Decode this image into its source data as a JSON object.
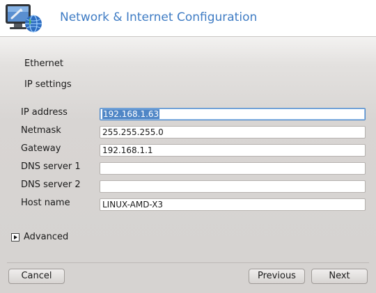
{
  "header": {
    "title": "Network & Internet Configuration",
    "logo_icon": "network-monitor-globe-icon"
  },
  "sections": {
    "ethernet": "Ethernet",
    "ip_settings": "IP settings"
  },
  "fields": {
    "ip_address": {
      "label": "IP address",
      "value": "192.168.1.63"
    },
    "netmask": {
      "label": "Netmask",
      "value": "255.255.255.0"
    },
    "gateway": {
      "label": "Gateway",
      "value": "192.168.1.1"
    },
    "dns1": {
      "label": "DNS server 1",
      "value": ""
    },
    "dns2": {
      "label": "DNS server 2",
      "value": ""
    },
    "hostname": {
      "label": "Host name",
      "value": "LINUX-AMD-X3"
    }
  },
  "advanced": {
    "label": "Advanced",
    "expanded": false
  },
  "buttons": {
    "cancel": "Cancel",
    "previous": "Previous",
    "next": "Next"
  },
  "colors": {
    "title": "#3f7cc4",
    "selection": "#4f86c6",
    "background": "#d6d3d1"
  }
}
